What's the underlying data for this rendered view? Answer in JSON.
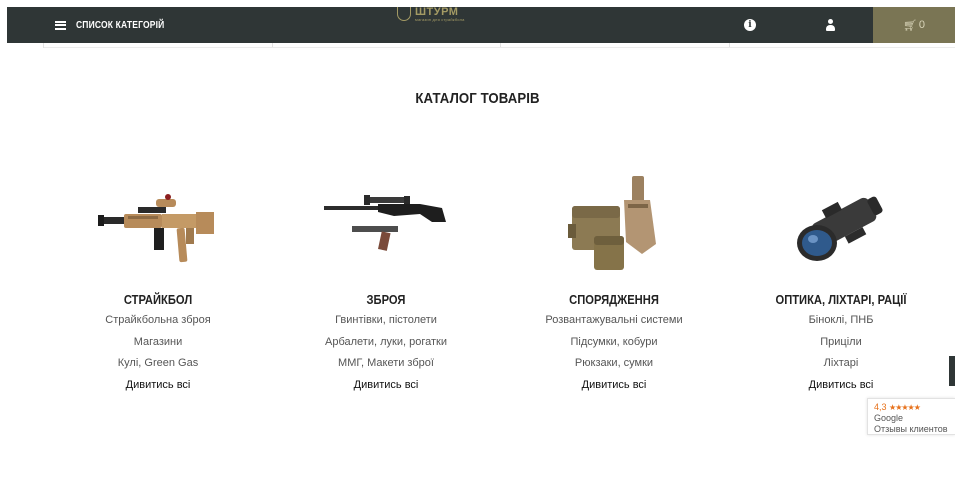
{
  "header": {
    "menu_label": "СПИСОК КАТЕГОРІЙ",
    "logo_text": "ШТУРМ",
    "logo_subtitle": "магазин для страйкбола",
    "cart_count": "0",
    "colors": {
      "bar": "#2f3636",
      "cart": "#7a7554",
      "accent": "#a39a64"
    }
  },
  "catalog": {
    "title": "КАТАЛОГ ТОВАРІВ",
    "categories": [
      {
        "name": "СТРАЙКБОЛ",
        "image": "airsoft-rifle-image",
        "links": [
          "Страйкбольна зброя",
          "Магазини",
          "Кулі, Green Gas"
        ],
        "view_all": "Дивитись всі"
      },
      {
        "name": "ЗБРОЯ",
        "image": "air-rifle-pistol-image",
        "links": [
          "Гвинтівки, пістолети",
          "Арбалети, луки, рогатки",
          "ММГ, Макети зброї"
        ],
        "view_all": "Дивитись всі"
      },
      {
        "name": "СПОРЯДЖЕННЯ",
        "image": "tactical-pouches-image",
        "links": [
          "Розвантажувальні системи",
          "Підсумки, кобури",
          "Рюкзаки, сумки"
        ],
        "view_all": "Дивитись всі"
      },
      {
        "name": "ОПТИКА, ЛІХТАРІ, РАЦІЇ",
        "image": "night-vision-image",
        "links": [
          "Біноклі, ПНБ",
          "Приціли",
          "Ліхтарі"
        ],
        "view_all": "Дивитись всі"
      }
    ]
  },
  "google_badge": {
    "rating": "4,3",
    "stars": "★★★★★",
    "brand": "Google",
    "reviews": "Отзывы клиентов"
  }
}
